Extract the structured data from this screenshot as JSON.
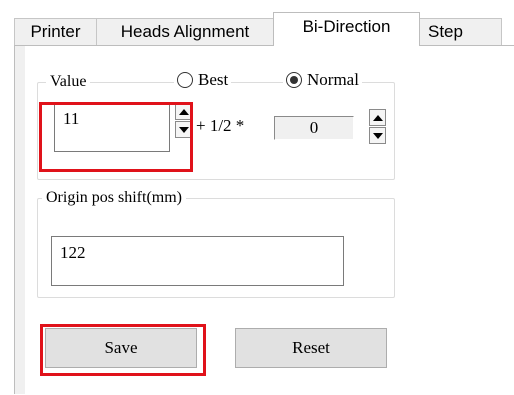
{
  "tabs": [
    {
      "label": "Printer",
      "active": false
    },
    {
      "label": "Heads Alignment",
      "active": false
    },
    {
      "label": "Bi-Direction",
      "active": true
    },
    {
      "label": "Step",
      "active": false
    }
  ],
  "value_group": {
    "legend": "Value",
    "radio_best_label": "Best",
    "radio_normal_label": "Normal",
    "selected": "Normal",
    "value_input": "11",
    "half_label": "+ 1/2 *",
    "half_value": "0"
  },
  "origin_group": {
    "legend": "Origin pos shift(mm)",
    "value_input": "122"
  },
  "buttons": {
    "save_label": "Save",
    "reset_label": "Reset"
  },
  "colors": {
    "highlight": "#e0121a",
    "panel_bg": "#f0f0f0",
    "button_bg": "#e1e1e1"
  }
}
